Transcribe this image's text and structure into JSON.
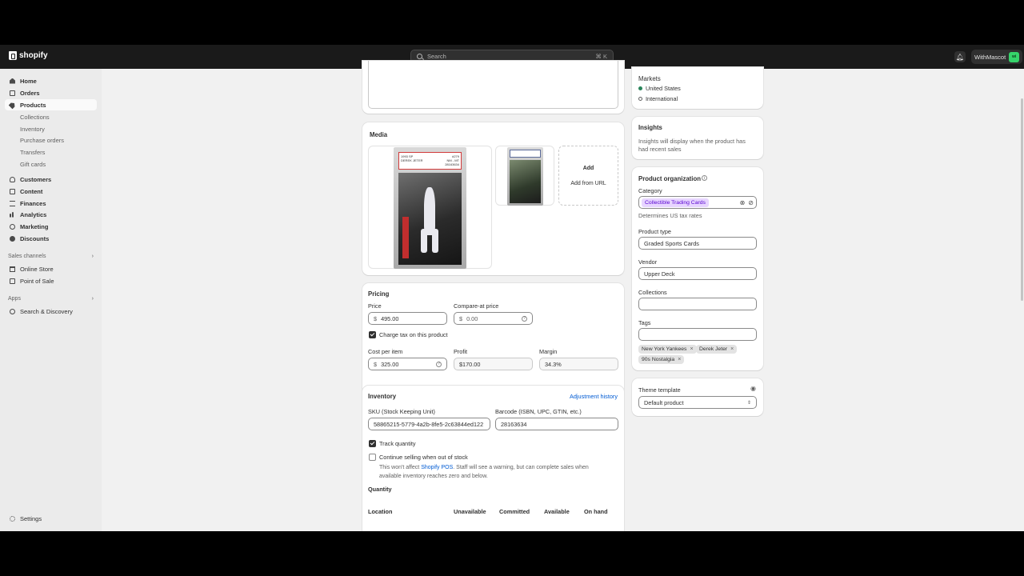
{
  "topbar": {
    "brand": "shopify",
    "search_placeholder": "Search",
    "search_shortcut": "⌘ K",
    "store_name": "WithMascot",
    "store_avatar": "wi"
  },
  "sidebar": {
    "items": [
      {
        "label": "Home",
        "icon": "home-icon"
      },
      {
        "label": "Orders",
        "icon": "orders-icon"
      },
      {
        "label": "Products",
        "icon": "tag-icon"
      },
      {
        "label": "Collections"
      },
      {
        "label": "Inventory"
      },
      {
        "label": "Purchase orders"
      },
      {
        "label": "Transfers"
      },
      {
        "label": "Gift cards"
      },
      {
        "label": "Customers",
        "icon": "person-icon"
      },
      {
        "label": "Content",
        "icon": "content-icon"
      },
      {
        "label": "Finances",
        "icon": "bank-icon"
      },
      {
        "label": "Analytics",
        "icon": "analytics-icon"
      },
      {
        "label": "Marketing",
        "icon": "target-icon"
      },
      {
        "label": "Discounts",
        "icon": "discount-icon"
      }
    ],
    "sales_channels_label": "Sales channels",
    "channels": [
      "Online Store",
      "Point of Sale"
    ],
    "apps_label": "Apps",
    "apps": [
      "Search & Discovery"
    ],
    "settings": "Settings"
  },
  "media": {
    "title": "Media",
    "add_label": "Add",
    "add_from_url": "Add from URL",
    "card_text": {
      "year": "1993 SP",
      "player": "DEREK JETER",
      "number": "#279",
      "grade": "NM - MT",
      "cert": "28163634"
    }
  },
  "pricing": {
    "title": "Pricing",
    "price_label": "Price",
    "price_value": "495.00",
    "compare_label": "Compare-at price",
    "compare_placeholder": "0.00",
    "currency": "$",
    "charge_tax_label": "Charge tax on this product",
    "cost_label": "Cost per item",
    "cost_value": "325.00",
    "profit_label": "Profit",
    "profit_value": "$170.00",
    "margin_label": "Margin",
    "margin_value": "34.3%"
  },
  "inventory": {
    "title": "Inventory",
    "adjustment_history": "Adjustment history",
    "sku_label": "SKU (Stock Keeping Unit)",
    "sku_value": "58865215-5779-4a2b-8fe5-2c63844ed122",
    "barcode_label": "Barcode (ISBN, UPC, GTIN, etc.)",
    "barcode_value": "28163634",
    "track_label": "Track quantity",
    "continue_label": "Continue selling when out of stock",
    "continue_help_1": "This won't affect ",
    "continue_help_link": "Shopify POS",
    "continue_help_2": ". Staff will see a warning, but can complete sales when",
    "continue_help_3": "available inventory reaches zero and below.",
    "quantity_label": "Quantity",
    "columns": [
      "Location",
      "Unavailable",
      "Committed",
      "Available",
      "On hand"
    ]
  },
  "markets": {
    "title": "Markets",
    "items": [
      {
        "label": "United States",
        "active": true
      },
      {
        "label": "International",
        "active": false
      }
    ]
  },
  "insights": {
    "title": "Insights",
    "text_1": "Insights will display when the product has",
    "text_2": "had recent sales"
  },
  "organization": {
    "title": "Product organization",
    "category_label": "Category",
    "category_value": "Collectible Trading Cards",
    "category_help": "Determines US tax rates",
    "type_label": "Product type",
    "type_value": "Graded Sports Cards",
    "vendor_label": "Vendor",
    "vendor_value": "Upper Deck",
    "collections_label": "Collections",
    "tags_label": "Tags",
    "tags": [
      "New York Yankees",
      "Derek Jeter",
      "90s Nostalgia"
    ]
  },
  "theme": {
    "title": "Theme template",
    "value": "Default product"
  },
  "colors": {
    "accent": "#005bd3",
    "market_active": "#29845a",
    "category_chip": "#e7d5ff"
  }
}
